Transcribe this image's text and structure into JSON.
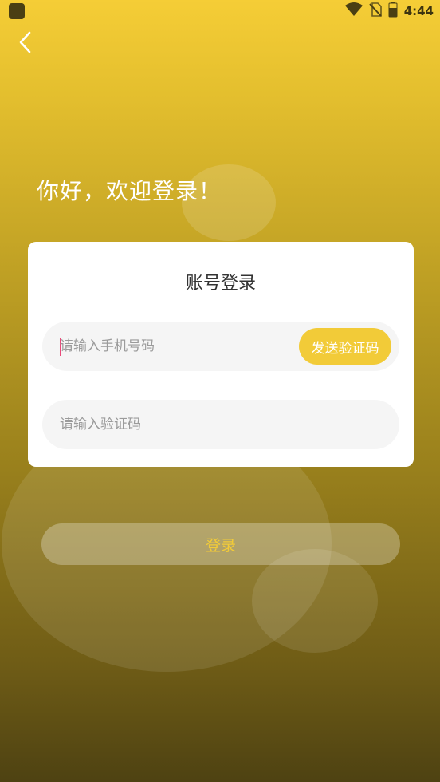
{
  "status_bar": {
    "time": "4:44",
    "icons": [
      "wifi-icon",
      "no-sim-icon",
      "battery-icon"
    ]
  },
  "header": {
    "back_icon": "chevron-left-icon"
  },
  "greeting": "你好，欢迎登录！",
  "card": {
    "title": "账号登录",
    "phone": {
      "placeholder": "请输入手机号码",
      "value": ""
    },
    "send_code_label": "发送验证码",
    "code": {
      "placeholder": "请输入验证码",
      "value": ""
    }
  },
  "login_label": "登录",
  "colors": {
    "accent": "#f2cb38",
    "caret": "#e94a7a",
    "card_background": "#ffffff",
    "input_background": "#f5f5f5"
  }
}
